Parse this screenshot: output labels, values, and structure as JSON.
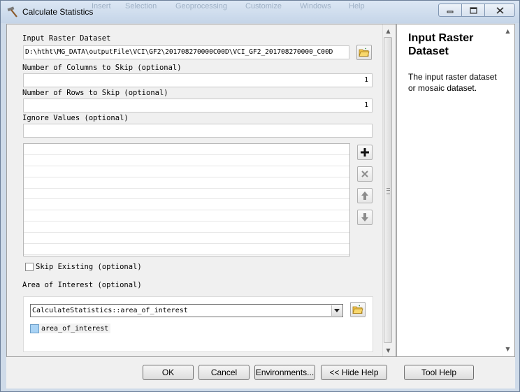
{
  "window": {
    "title": "Calculate Statistics",
    "ghost_menu": [
      "Insert",
      "Selection",
      "Geoprocessing",
      "Customize",
      "Windows",
      "Help"
    ]
  },
  "params": {
    "input_raster": {
      "label": "Input Raster Dataset",
      "value": "D:\\htht\\MG_DATA\\outputFile\\VCI\\GF2\\201708270000C00D\\VCI_GF2_201708270000_C00D"
    },
    "columns_to_skip": {
      "label": "Number of Columns to Skip (optional)",
      "value": "1"
    },
    "rows_to_skip": {
      "label": "Number of Rows to Skip (optional)",
      "value": "1"
    },
    "ignore_values": {
      "label": "Ignore Values (optional)",
      "value": ""
    },
    "skip_existing": {
      "label": "Skip Existing (optional)",
      "checked": false
    },
    "area_of_interest": {
      "label": "Area of Interest (optional)",
      "combo_value": "CalculateStatistics::area_of_interest",
      "layer_item": "area_of_interest",
      "layer_color": "#a9d3f5"
    }
  },
  "list_buttons": {
    "add_icon": "plus-icon",
    "remove_icon": "x-icon",
    "up_icon": "arrow-up-icon",
    "down_icon": "arrow-down-icon"
  },
  "help": {
    "title": "Input Raster Dataset",
    "body": "The input raster dataset or mosaic dataset."
  },
  "buttons": {
    "ok": "OK",
    "cancel": "Cancel",
    "environments": "Environments...",
    "hide_help": "<< Hide Help",
    "tool_help": "Tool Help"
  }
}
